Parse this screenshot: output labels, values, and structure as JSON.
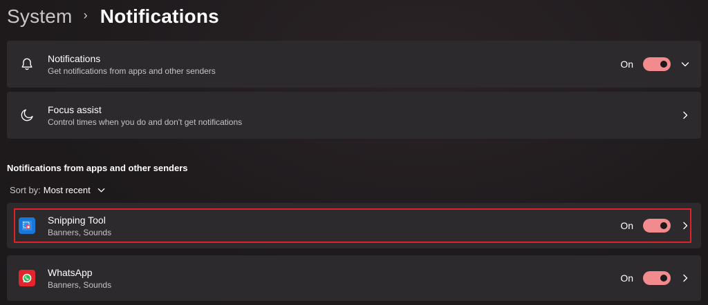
{
  "breadcrumb": {
    "parent": "System",
    "separator": "›",
    "current": "Notifications"
  },
  "notifications_card": {
    "icon": "bell-icon",
    "title": "Notifications",
    "subtitle": "Get notifications from apps and other senders",
    "state_label": "On",
    "toggle_on": true,
    "chevron": "chevron-down-icon"
  },
  "focus_card": {
    "icon": "moon-icon",
    "title": "Focus assist",
    "subtitle": "Control times when you do and don't get notifications",
    "chevron": "chevron-right-icon"
  },
  "apps_section": {
    "heading": "Notifications from apps and other senders",
    "sort_label": "Sort by:",
    "sort_value": "Most recent",
    "apps": [
      {
        "icon": "snipping-tool-icon",
        "name": "Snipping Tool",
        "subtitle": "Banners, Sounds",
        "state_label": "On",
        "toggle_on": true,
        "highlighted": true
      },
      {
        "icon": "whatsapp-icon",
        "name": "WhatsApp",
        "subtitle": "Banners, Sounds",
        "state_label": "On",
        "toggle_on": true,
        "highlighted": false
      }
    ]
  },
  "colors": {
    "toggle_on": "#f28b8d",
    "card_bg": "#2c2a2c",
    "highlight_border": "#e0202b",
    "whatsapp_red": "#e3262e",
    "snipping_blue": "#1a78d6"
  }
}
